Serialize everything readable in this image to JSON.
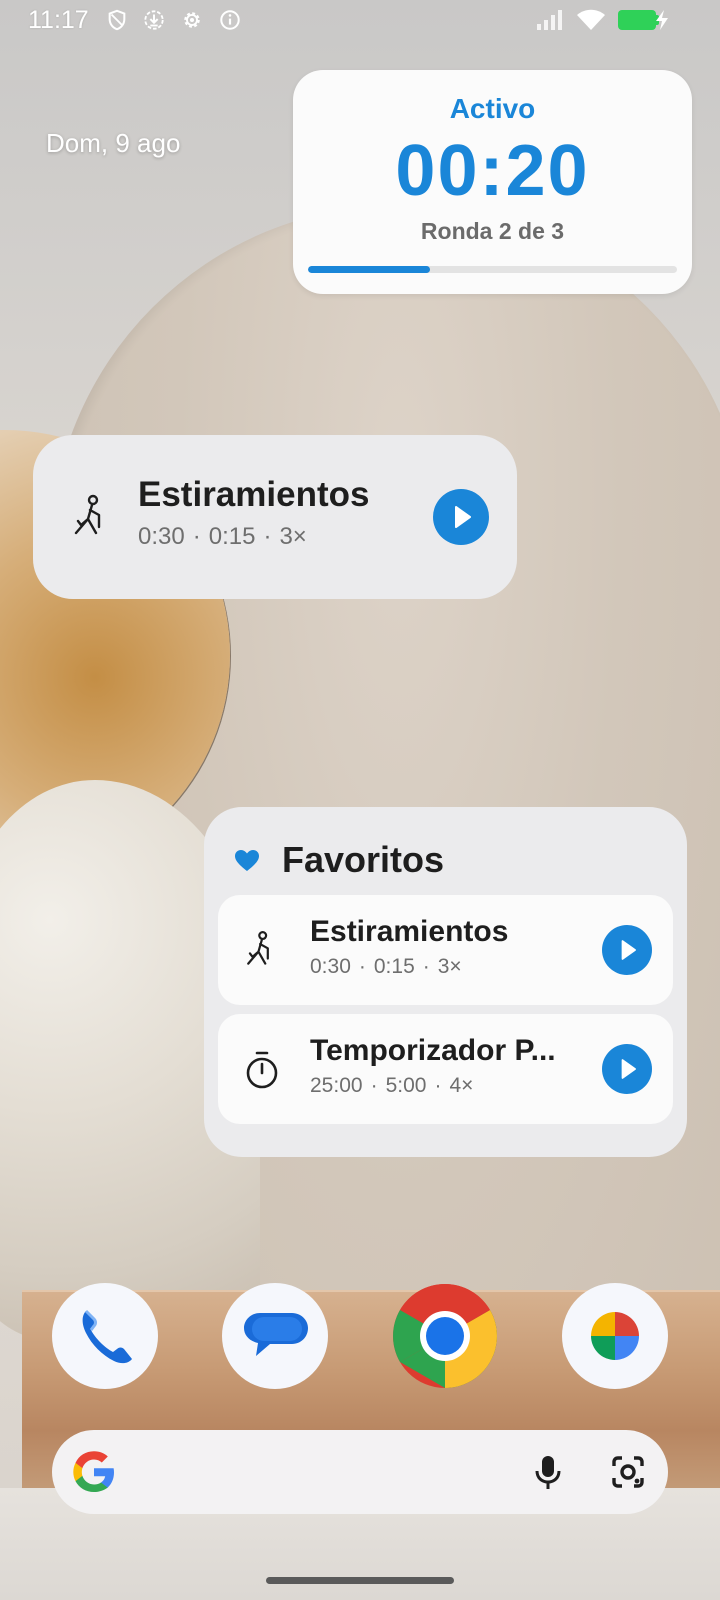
{
  "status_bar": {
    "time": "11:17",
    "icons": [
      "shield-icon",
      "download-icon",
      "settings-icon",
      "info-icon",
      "signal-icon",
      "wifi-icon",
      "battery-charging-icon"
    ],
    "battery_color": "#2fd158"
  },
  "date": "Dom, 9 ago",
  "timer_widget": {
    "status": "Activo",
    "time": "00:20",
    "round": "Ronda 2 de 3",
    "progress_fraction": 0.33,
    "accent_color": "#1a86d8"
  },
  "workout_widget": {
    "title": "Estiramientos",
    "work": "0:30",
    "rest": "0:15",
    "reps": "3×",
    "icon": "stretching-figure-icon"
  },
  "favorites_widget": {
    "title": "Favoritos",
    "items": [
      {
        "title": "Estiramientos",
        "work": "0:30",
        "rest": "0:15",
        "reps": "3×",
        "icon": "stretching-figure-icon"
      },
      {
        "title": "Temporizador P...",
        "work": "25:00",
        "rest": "5:00",
        "reps": "4×",
        "icon": "stopwatch-icon"
      }
    ]
  },
  "dock": {
    "apps": [
      "phone-app-icon",
      "messages-app-icon",
      "chrome-app-icon",
      "photos-app-icon"
    ]
  },
  "search_bar": {
    "icons": [
      "google-logo-icon",
      "microphone-icon",
      "google-lens-icon"
    ]
  },
  "separator": "·"
}
